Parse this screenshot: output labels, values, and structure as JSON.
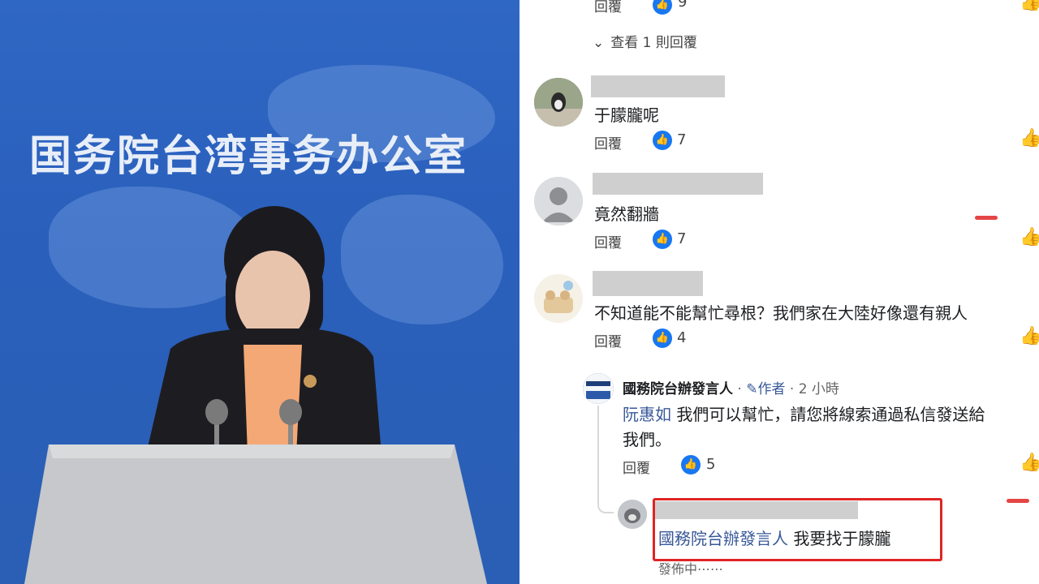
{
  "left": {
    "banner": "国务院台湾事务办公室"
  },
  "thread": {
    "top_count": "9",
    "view_replies": "查看 1 則回覆",
    "reply_label": "回覆",
    "comments": [
      {
        "text": "于朦朧呢",
        "likes": "7"
      },
      {
        "text": "竟然翻牆",
        "likes": "7"
      },
      {
        "text": "不知道能不能幫忙尋根？我們家在大陸好像還有親人",
        "likes": "4"
      }
    ],
    "page_reply": {
      "author": "國務院台辦發言人",
      "separator": "·",
      "author_badge": "作者",
      "time": "2 小時",
      "mention": "阮惠如",
      "text_line1": "我們可以幫忙，請您將線索通過私信發送給",
      "text_line2": "我們。",
      "likes": "5"
    },
    "pending_reply": {
      "mention": "國務院台辦發言人",
      "text": "我要找于朦朧",
      "status": "發佈中⋯⋯"
    }
  },
  "colors": {
    "accent": "#1877f2",
    "highlight": "#e02424",
    "link": "#385898"
  }
}
